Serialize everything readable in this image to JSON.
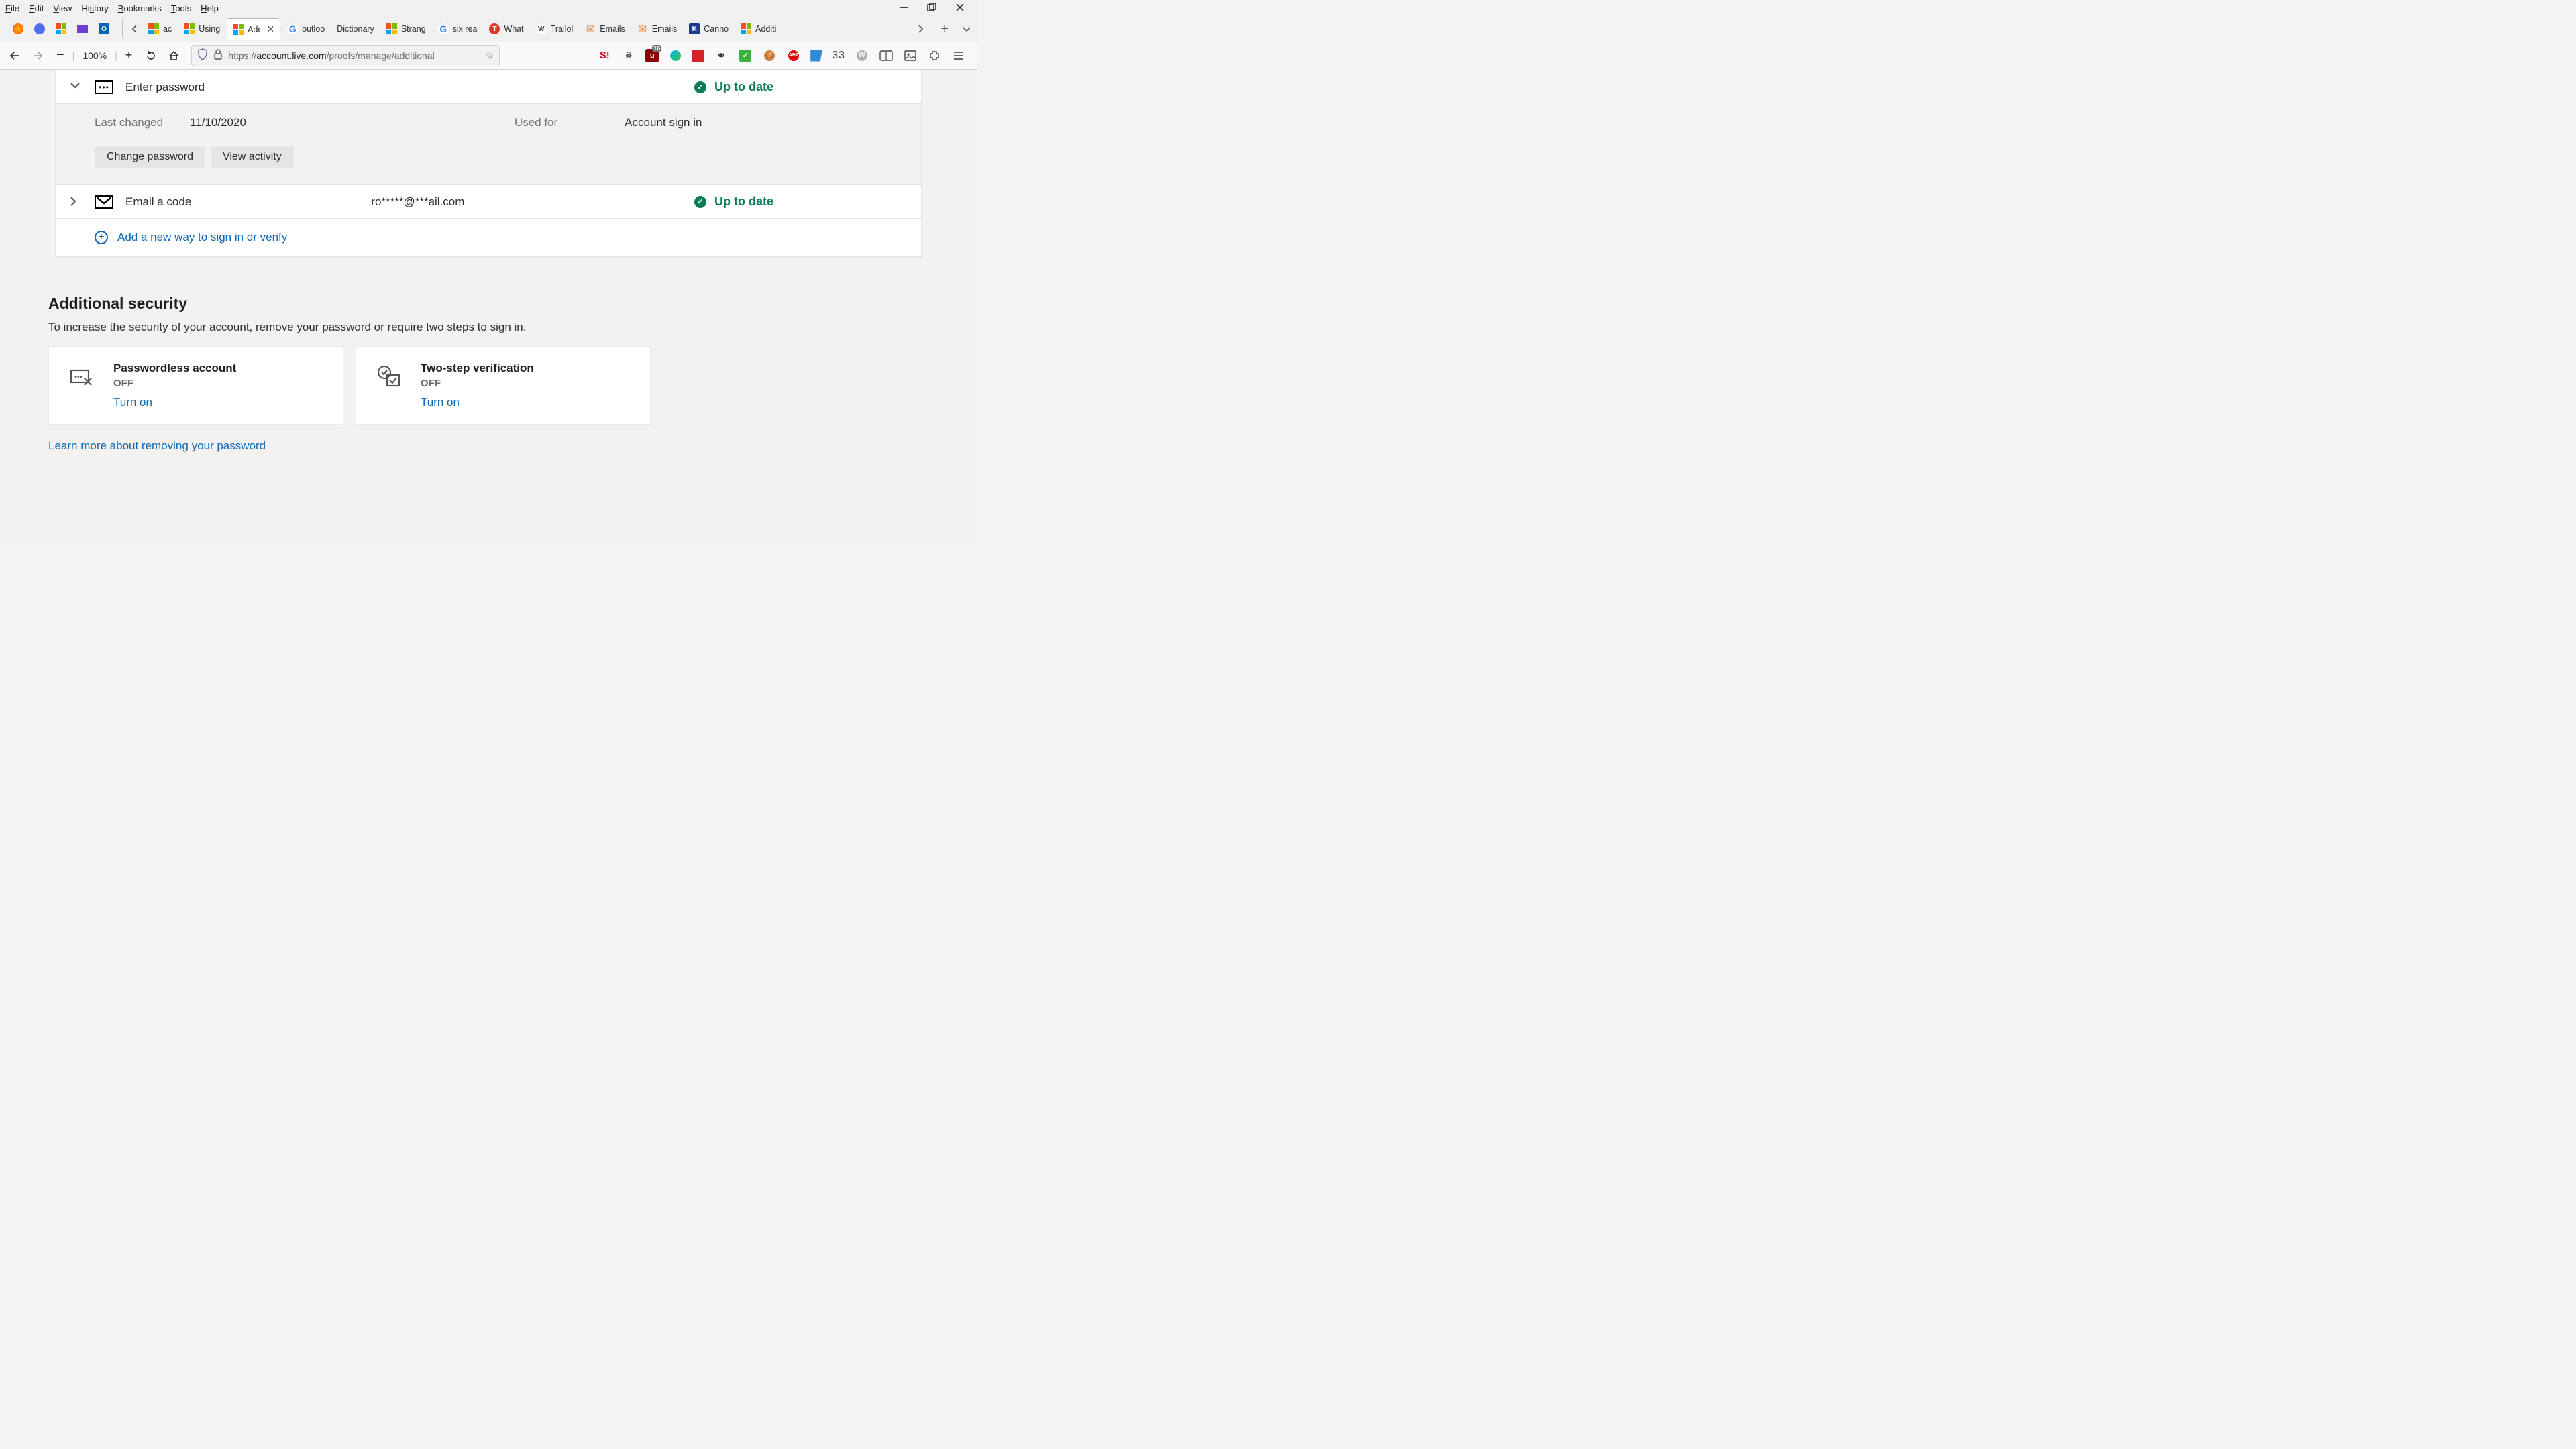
{
  "menu": {
    "file": "File",
    "edit": "Edit",
    "view": "View",
    "history": "History",
    "bookmarks": "Bookmarks",
    "tools": "Tools",
    "help": "Help"
  },
  "tabs": {
    "items": [
      {
        "label": "ac",
        "fav": "ms"
      },
      {
        "label": "Using",
        "fav": "ms"
      },
      {
        "label": "Adc",
        "fav": "ms",
        "active": true
      },
      {
        "label": "outloo",
        "fav": "g"
      },
      {
        "label": "Dictionary",
        "fav": ""
      },
      {
        "label": "Strang",
        "fav": "ms"
      },
      {
        "label": "six rea",
        "fav": "g"
      },
      {
        "label": "What",
        "fav": "t"
      },
      {
        "label": "Trailol",
        "fav": "w"
      },
      {
        "label": "Emails",
        "fav": "env"
      },
      {
        "label": "Emails",
        "fav": "env"
      },
      {
        "label": "Canno",
        "fav": "k"
      },
      {
        "label": "Additi",
        "fav": "ms"
      }
    ]
  },
  "toolbar": {
    "zoom": "100%",
    "url_prefix": "https://",
    "url_host": "account.live.com",
    "url_path": "/proofs/manage/additional",
    "ext_badge": "16",
    "ext_count": "33"
  },
  "password_row": {
    "title": "Enter password",
    "status": "Up to date",
    "last_changed_label": "Last changed",
    "last_changed_value": "11/10/2020",
    "used_for_label": "Used for",
    "used_for_value": "Account sign in",
    "change_btn": "Change password",
    "view_btn": "View activity"
  },
  "email_row": {
    "title": "Email a code",
    "email": "ro*****@***ail.com",
    "status": "Up to date"
  },
  "add_row": {
    "label": "Add a new way to sign in or verify"
  },
  "additional": {
    "heading": "Additional security",
    "subtitle": "To increase the security of your account, remove your password or require two steps to sign in.",
    "passwordless": {
      "title": "Passwordless account",
      "state": "OFF",
      "link": "Turn on"
    },
    "twostep": {
      "title": "Two-step verification",
      "state": "OFF",
      "link": "Turn on"
    },
    "learn": "Learn more about removing your password"
  }
}
